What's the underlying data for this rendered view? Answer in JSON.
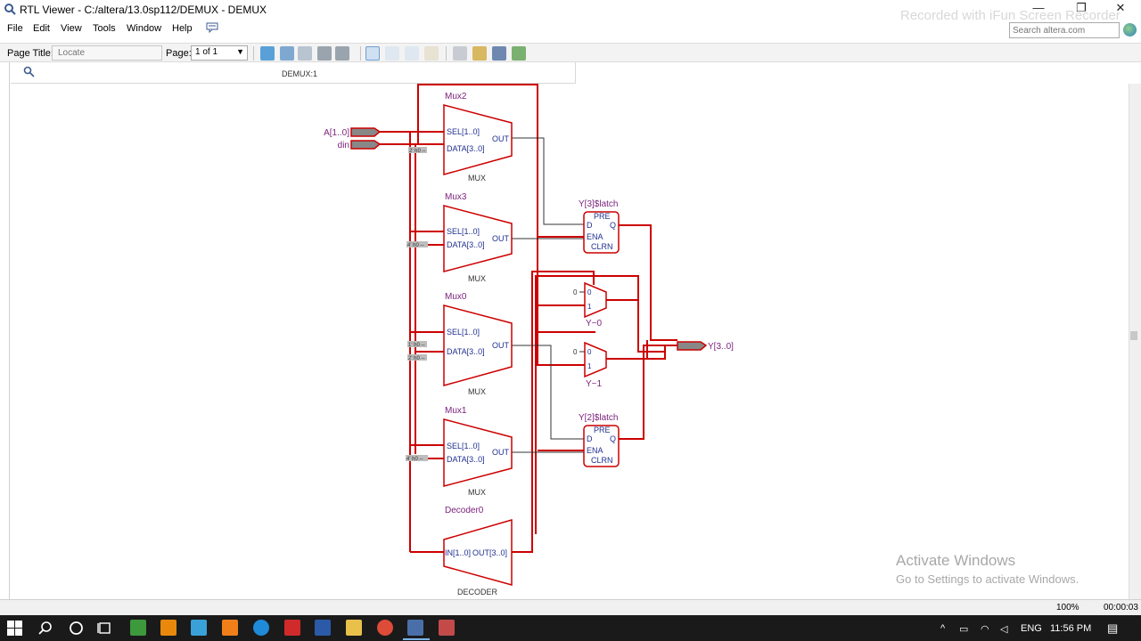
{
  "window": {
    "title": "RTL Viewer - C:/altera/13.0sp112/DEMUX - DEMUX",
    "minimize_glyph": "—",
    "maximize_glyph": "❐",
    "close_glyph": "✕"
  },
  "recorder_overlay": "Recorded with iFun Screen Recorder",
  "menu": [
    "File",
    "Edit",
    "View",
    "Tools",
    "Window",
    "Help"
  ],
  "help_search": {
    "placeholder": "Search altera.com"
  },
  "toolbar": {
    "page_title_label": "Page Title:",
    "page_title_placeholder": "Locate",
    "page_label": "Page:",
    "page_value": "1 of 1"
  },
  "document": {
    "tab_label": "DEMUX:1"
  },
  "schematic": {
    "inputs": [
      "A[1..0]",
      "din"
    ],
    "output": "Y[3..0]",
    "muxes": [
      {
        "name": "Mux2",
        "type": "MUX",
        "sel": "SEL[1..0]",
        "data": "DATA[3..0]",
        "out": "OUT",
        "constants": [
          "2' h0 --"
        ]
      },
      {
        "name": "Mux3",
        "type": "MUX",
        "sel": "SEL[1..0]",
        "data": "DATA[3..0]",
        "out": "OUT",
        "constants": [
          "4' h0 --"
        ]
      },
      {
        "name": "Mux0",
        "type": "MUX",
        "sel": "SEL[1..0]",
        "data": "DATA[3..0]",
        "out": "OUT",
        "constants": [
          "1' h0 --",
          "2' h0 --"
        ]
      },
      {
        "name": "Mux1",
        "type": "MUX",
        "sel": "SEL[1..0]",
        "data": "DATA[3..0]",
        "out": "OUT",
        "constants": [
          "4' h0 --"
        ]
      }
    ],
    "decoder": {
      "name": "Decoder0",
      "type": "DECODER",
      "in": "IN[1..0]",
      "out": "OUT[3..0]"
    },
    "latches": [
      {
        "name": "Y[3]$latch",
        "pins": [
          "PRE",
          "D",
          "Q",
          "ENA",
          "CLRN"
        ]
      },
      {
        "name": "Y[2]$latch",
        "pins": [
          "PRE",
          "D",
          "Q",
          "ENA",
          "CLRN"
        ]
      }
    ],
    "small_muxes": [
      {
        "name": "Y~0",
        "zero": "0",
        "one": "1",
        "const": "0"
      },
      {
        "name": "Y~1",
        "zero": "0",
        "one": "1",
        "const": "0"
      }
    ]
  },
  "status": {
    "zoom": "100%",
    "elapsed": "00:00:03"
  },
  "watermark": {
    "title": "Activate Windows",
    "subtitle": "Go to Settings to activate Windows."
  },
  "taskbar": {
    "language": "ENG",
    "time": "11:56 PM"
  },
  "colors": {
    "wire": "#cc0000",
    "label": "#7a1f7a",
    "pin_text": "#1f2f8f",
    "taskbar": "#1a1a1a"
  }
}
